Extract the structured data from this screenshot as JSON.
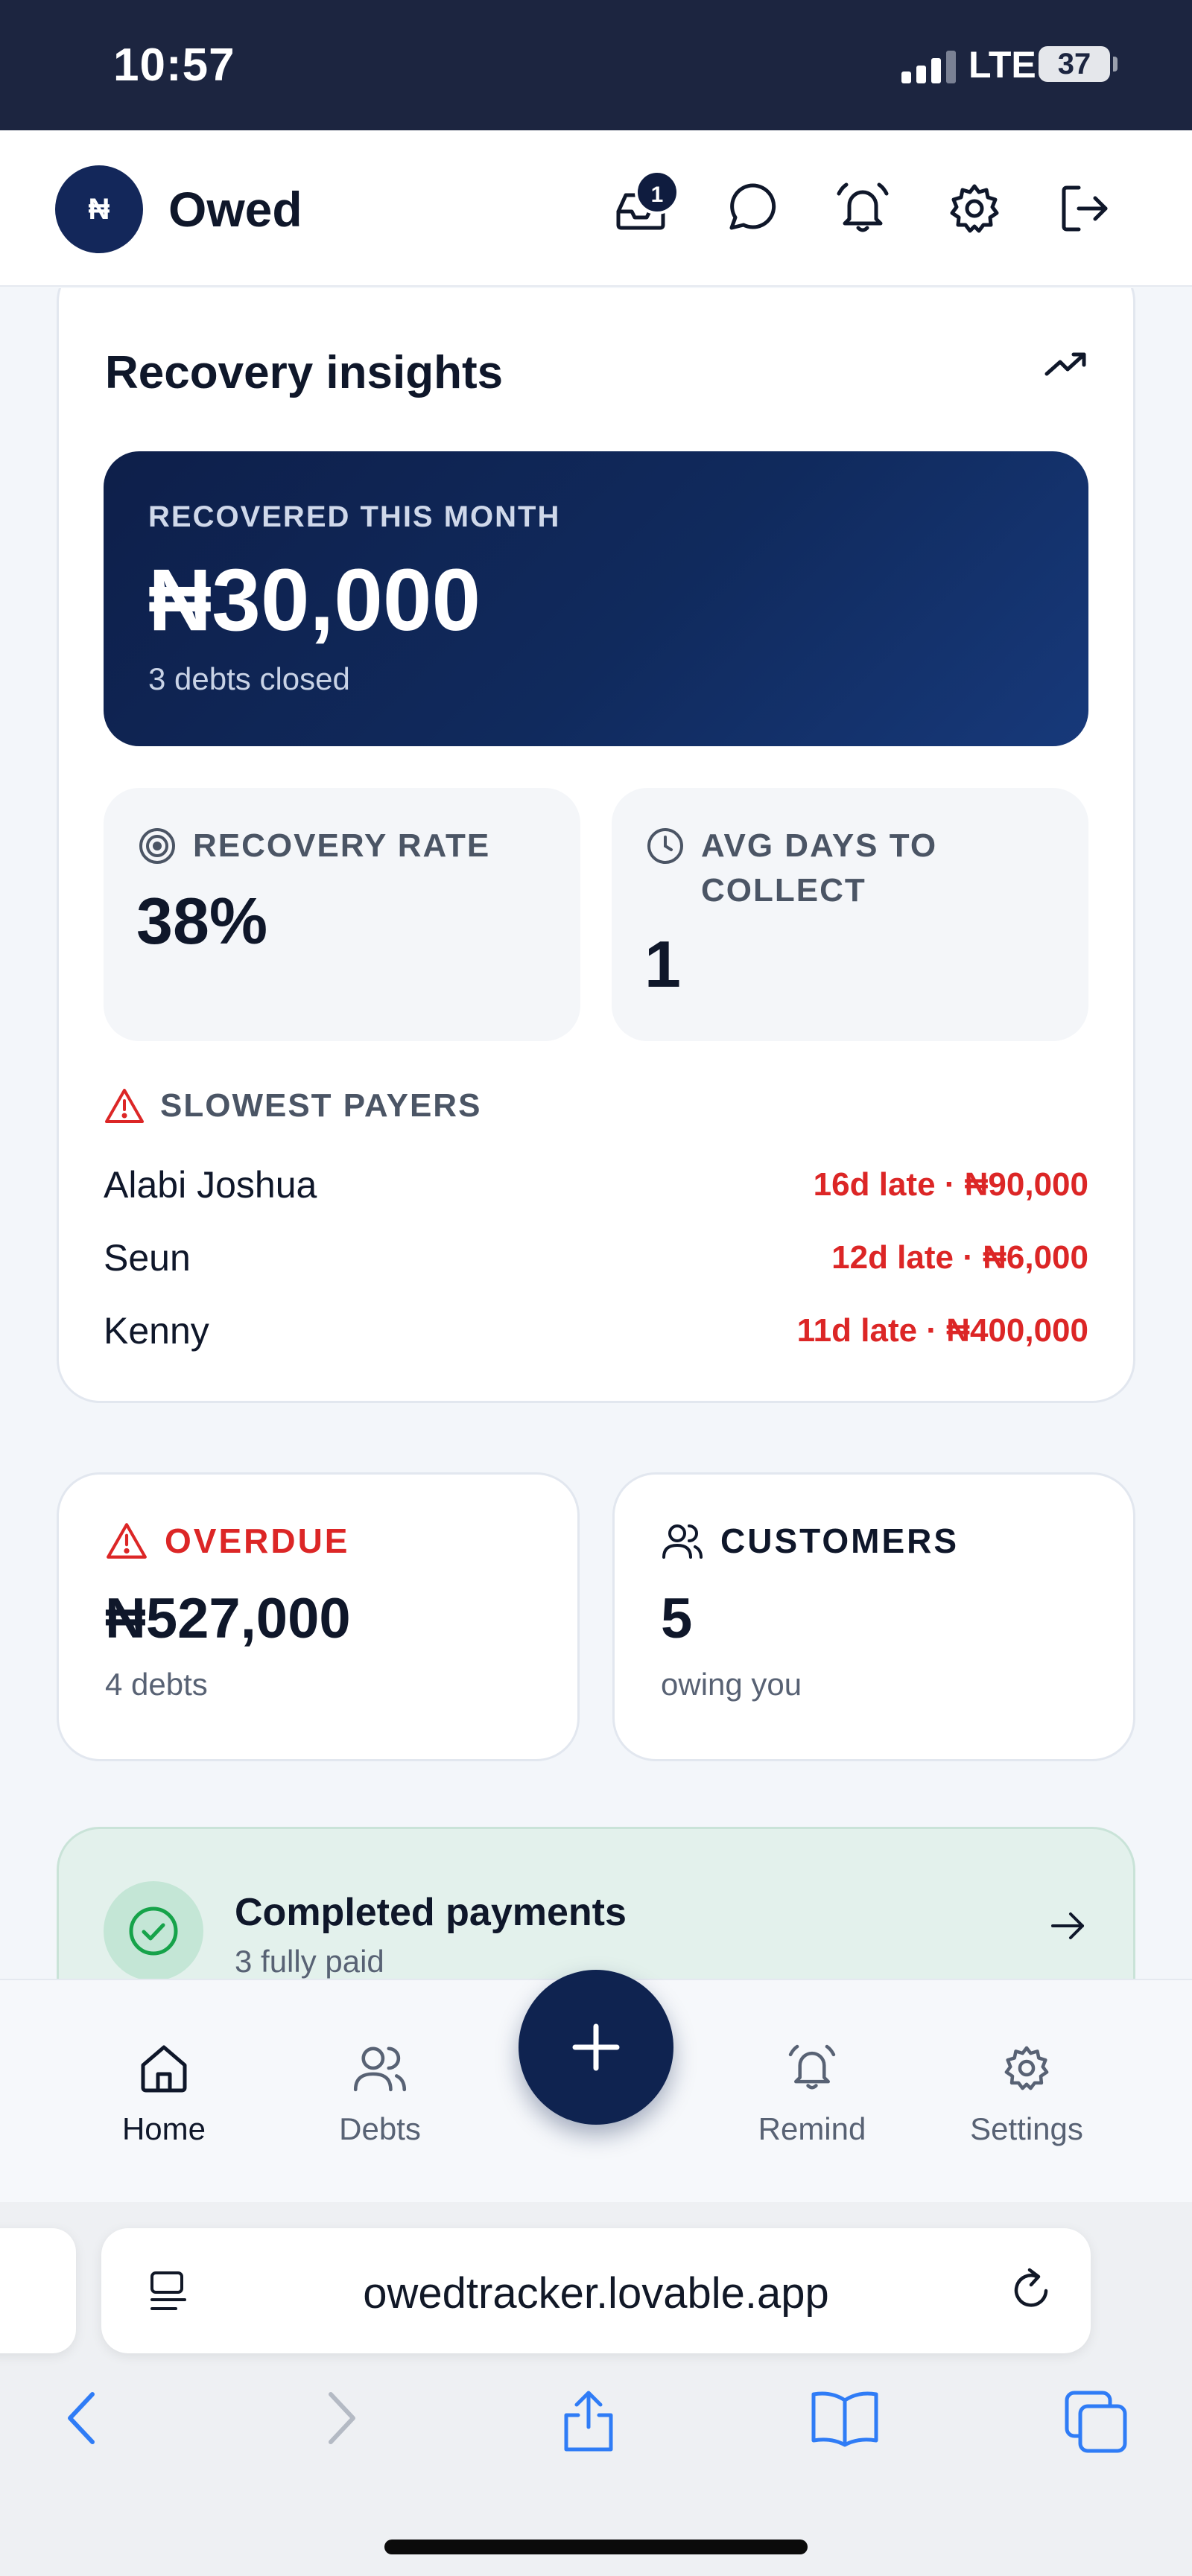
{
  "status_bar": {
    "time": "10:57",
    "network": "LTE",
    "battery": "37"
  },
  "header": {
    "logo_text": "₦",
    "app_name": "Owed",
    "inbox_badge": "1",
    "icons": [
      "inbox-icon",
      "message-icon",
      "bell-icon",
      "gear-icon",
      "logout-icon"
    ]
  },
  "insights": {
    "title": "Recovery insights",
    "recovered": {
      "label": "RECOVERED THIS MONTH",
      "amount": "₦30,000",
      "sub": "3 debts closed"
    },
    "recovery_rate": {
      "label": "RECOVERY RATE",
      "value": "38%"
    },
    "avg_days": {
      "label": "AVG DAYS TO COLLECT",
      "value": "1"
    },
    "slowest": {
      "label": "SLOWEST PAYERS",
      "payers": [
        {
          "name": "Alabi Joshua",
          "detail": "16d late · ₦90,000"
        },
        {
          "name": "Seun",
          "detail": "12d late · ₦6,000"
        },
        {
          "name": "Kenny",
          "detail": "11d late · ₦400,000"
        }
      ]
    }
  },
  "overdue": {
    "title": "OVERDUE",
    "value": "₦527,000",
    "sub": "4 debts"
  },
  "customers": {
    "title": "CUSTOMERS",
    "value": "5",
    "sub": "owing you"
  },
  "completed": {
    "title": "Completed payments",
    "sub": "3 fully paid"
  },
  "nav": {
    "home": "Home",
    "debts": "Debts",
    "remind": "Remind",
    "settings": "Settings"
  },
  "browser": {
    "url": "owedtracker.lovable.app"
  },
  "colors": {
    "navy": "#0f2350",
    "danger": "#dc2626",
    "success": "#16a34a"
  }
}
